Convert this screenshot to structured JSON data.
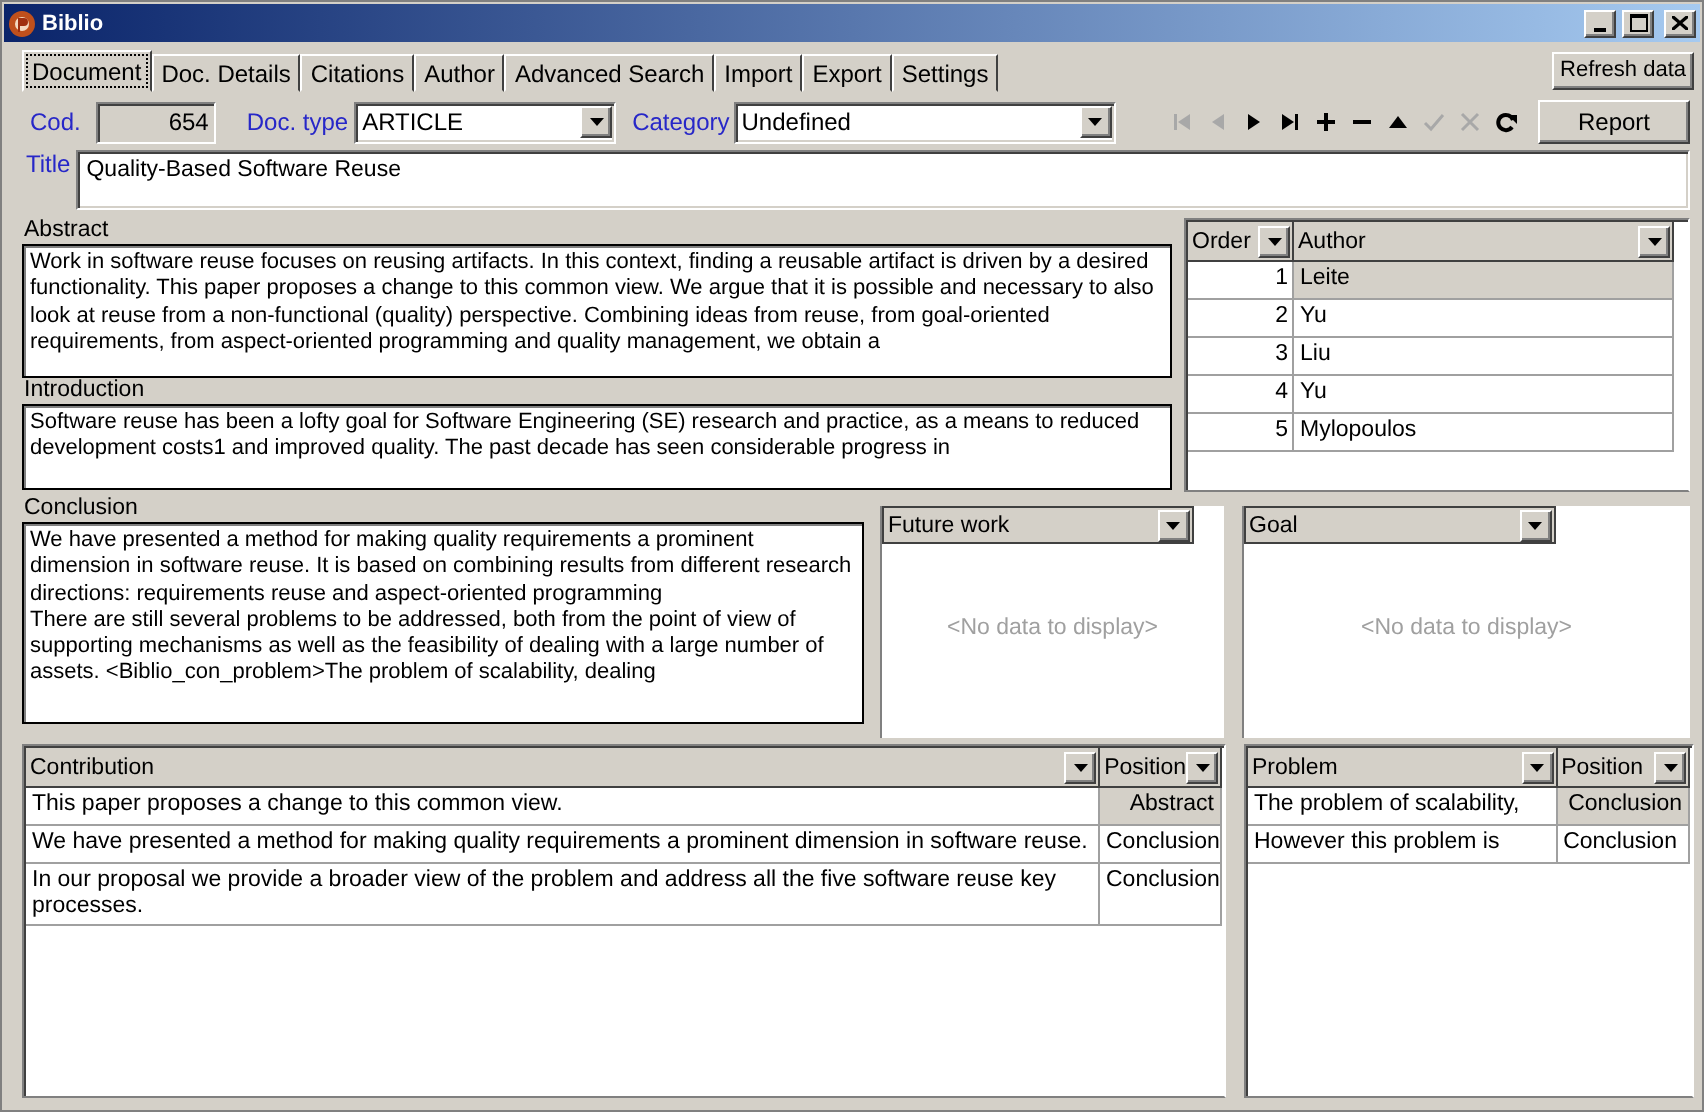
{
  "window": {
    "title": "Biblio"
  },
  "tabs": [
    {
      "label": "Document",
      "selected": true
    },
    {
      "label": "Doc. Details",
      "selected": false
    },
    {
      "label": "Citations",
      "selected": false
    },
    {
      "label": "Author",
      "selected": false
    },
    {
      "label": "Advanced Search",
      "selected": false
    },
    {
      "label": "Import",
      "selected": false
    },
    {
      "label": "Export",
      "selected": false
    },
    {
      "label": "Settings",
      "selected": false
    }
  ],
  "refresh_button": "Refresh data",
  "code": {
    "label": "Cod.",
    "value": "654"
  },
  "doc_type": {
    "label": "Doc. type",
    "value": "ARTICLE"
  },
  "category": {
    "label": "Category",
    "value": "Undefined"
  },
  "navigator": [
    {
      "kind": "first",
      "disabled": true
    },
    {
      "kind": "prior",
      "disabled": true
    },
    {
      "kind": "next",
      "disabled": false
    },
    {
      "kind": "last",
      "disabled": false
    },
    {
      "kind": "insert",
      "disabled": false
    },
    {
      "kind": "delete",
      "disabled": false
    },
    {
      "kind": "edit",
      "disabled": false
    },
    {
      "kind": "post",
      "disabled": true
    },
    {
      "kind": "cancel",
      "disabled": true
    },
    {
      "kind": "refresh",
      "disabled": false
    }
  ],
  "report_button": "Report",
  "title": {
    "label": "Title",
    "value": "Quality-Based Software Reuse"
  },
  "abstract": {
    "label": "Abstract",
    "text": "Work in software reuse focuses on reusing artifacts. In this context, finding a reusable artifact is driven by a desired functionality. This paper proposes a change to this common view. We argue that it is possible and necessary to also look at reuse from a non-functional (quality) perspective. Combining ideas from reuse, from goal-oriented requirements, from aspect-oriented programming and quality management, we obtain a"
  },
  "introduction": {
    "label": "Introduction",
    "text": "Software reuse has been a lofty goal for Software Engineering (SE) research and practice, as a means to reduced development costs1 and improved quality. The past decade has seen considerable progress in"
  },
  "authors": {
    "columns": [
      "Order",
      "Author"
    ],
    "rows": [
      {
        "cells": [
          "1",
          "Leite"
        ],
        "selected": true
      },
      {
        "cells": [
          "2",
          "Yu"
        ],
        "selected": false
      },
      {
        "cells": [
          "3",
          "Liu"
        ],
        "selected": false
      },
      {
        "cells": [
          "4",
          "Yu"
        ],
        "selected": false
      },
      {
        "cells": [
          "5",
          "Mylopoulos"
        ],
        "selected": false
      }
    ]
  },
  "conclusion": {
    "label": "Conclusion",
    "text": "We have presented a method for making quality requirements a prominent dimension in software reuse. It is based on combining results from different research directions: requirements reuse and aspect-oriented programming\nThere are still several problems to be addressed, both from the point of view of supporting mechanisms as well as the feasibility of dealing with a large number of assets. <Biblio_con_problem>The problem of scalability, dealing"
  },
  "future_work": {
    "value": "Future work",
    "empty_text": "<No data to display>"
  },
  "goal": {
    "value": "Goal",
    "empty_text": "<No data to display>"
  },
  "contributions": {
    "columns": [
      "Contribution",
      "Position"
    ],
    "rows": [
      {
        "cells": [
          "This paper proposes a change to this common view.",
          "Abstract"
        ],
        "selected": true
      },
      {
        "cells": [
          "We have presented a method for making quality requirements a prominent dimension in software reuse.",
          "Conclusion"
        ],
        "selected": false
      },
      {
        "cells": [
          "In our proposal we provide a broader view of the problem and address all the five software reuse key processes.",
          "Conclusion"
        ],
        "selected": false
      }
    ]
  },
  "problems": {
    "columns": [
      "Problem",
      "Position"
    ],
    "rows": [
      {
        "cells": [
          "The problem of scalability,",
          "Conclusion"
        ],
        "selected": true
      },
      {
        "cells": [
          "However this problem is",
          "Conclusion"
        ],
        "selected": false
      }
    ]
  }
}
